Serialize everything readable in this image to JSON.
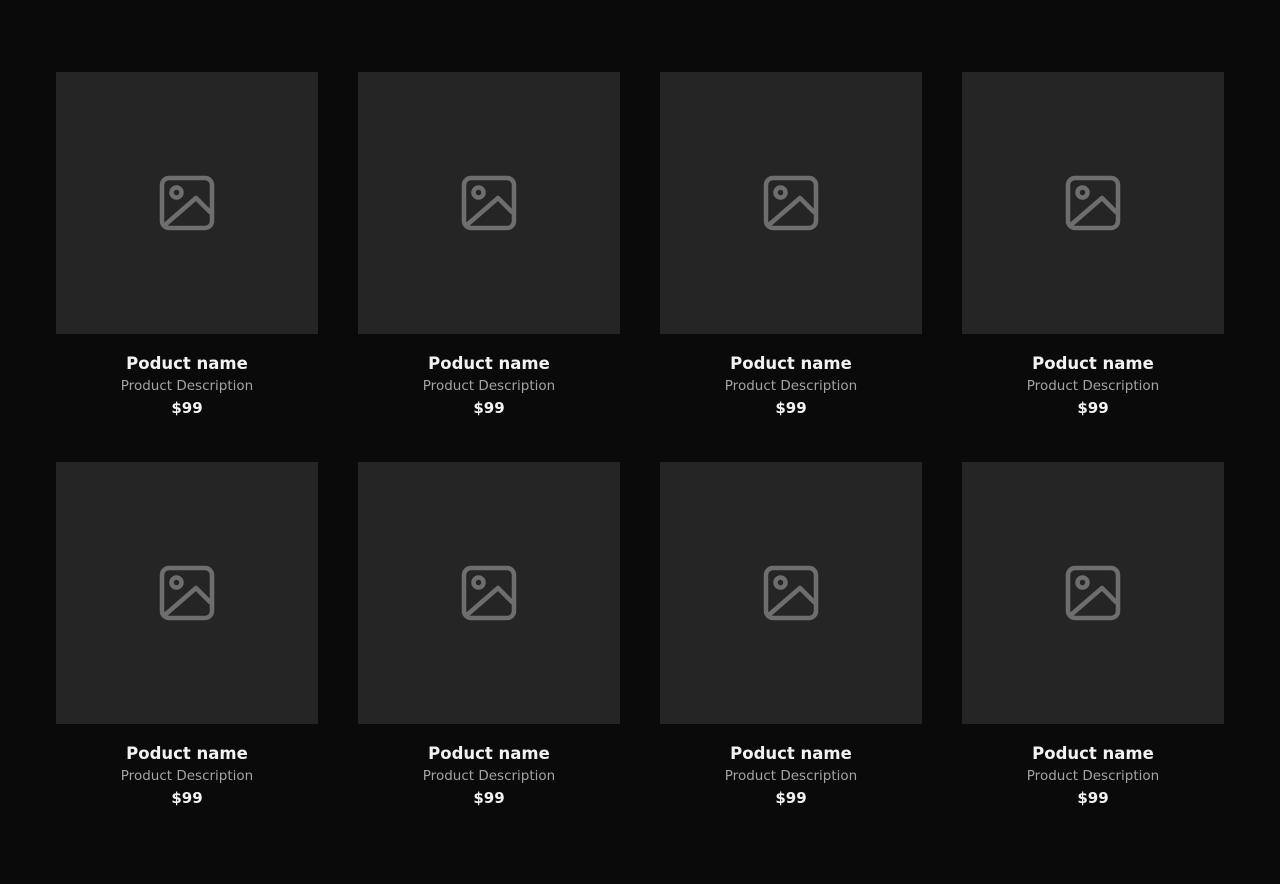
{
  "colors": {
    "background": "#0a0a0a",
    "image_placeholder": "#252525",
    "icon": "#6e6e6e",
    "name_text": "#f2f2f2",
    "description_text": "#a3a3a3"
  },
  "products": [
    {
      "name": "Poduct name",
      "description": "Product Description",
      "price": "$99",
      "icon": "image-placeholder-icon"
    },
    {
      "name": "Poduct name",
      "description": "Product Description",
      "price": "$99",
      "icon": "image-placeholder-icon"
    },
    {
      "name": "Poduct name",
      "description": "Product Description",
      "price": "$99",
      "icon": "image-placeholder-icon"
    },
    {
      "name": "Poduct name",
      "description": "Product Description",
      "price": "$99",
      "icon": "image-placeholder-icon"
    },
    {
      "name": "Poduct name",
      "description": "Product Description",
      "price": "$99",
      "icon": "image-placeholder-icon"
    },
    {
      "name": "Poduct name",
      "description": "Product Description",
      "price": "$99",
      "icon": "image-placeholder-icon"
    },
    {
      "name": "Poduct name",
      "description": "Product Description",
      "price": "$99",
      "icon": "image-placeholder-icon"
    },
    {
      "name": "Poduct name",
      "description": "Product Description",
      "price": "$99",
      "icon": "image-placeholder-icon"
    }
  ]
}
